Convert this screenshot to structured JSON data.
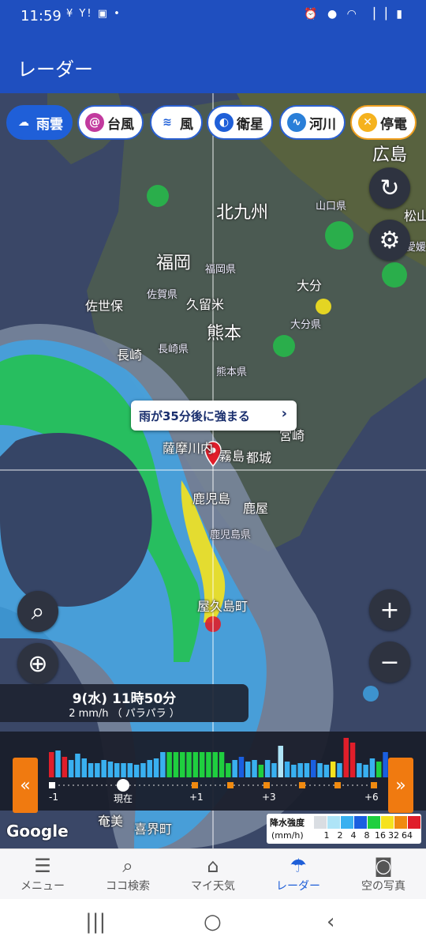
{
  "status_bar": {
    "time": "11:59",
    "left_icons": "¥ Y! ▣ •",
    "right_icons": "⏰ ● ◠ ▕▕ ▮"
  },
  "app_bar": {
    "title": "レーダー"
  },
  "layer_chips": [
    {
      "label": "雨雲",
      "icon": "cloud-rain-icon",
      "active": true
    },
    {
      "label": "台風",
      "icon": "typhoon-icon",
      "active": false
    },
    {
      "label": "風",
      "icon": "wind-icon",
      "active": false
    },
    {
      "label": "衛星",
      "icon": "satellite-icon",
      "active": false
    },
    {
      "label": "河川",
      "icon": "river-icon",
      "active": false
    },
    {
      "label": "停電",
      "icon": "power-outage-icon",
      "active": false
    }
  ],
  "map_labels": {
    "hiroshima": "広島",
    "yamaguchi_pref": "山口県",
    "matsuyama": "松山",
    "ehime_pref": "愛媛",
    "kitakyushu": "北九州",
    "fukuoka": "福岡",
    "fukuoka_pref": "福岡県",
    "saga_pref": "佐賀県",
    "kurume": "久留米",
    "sasebo": "佐世保",
    "oita": "大分",
    "oita_pref": "大分県",
    "kumamoto": "熊本",
    "nagasaki": "長崎",
    "nagasaki_pref": "長崎県",
    "kumamoto_pref": "熊本県",
    "miyazaki": "宮崎",
    "satsumasendai": "薩摩川内",
    "kirishima": "霧島",
    "miyakonojo": "都城",
    "kagoshima": "鹿児島",
    "kanoya": "鹿屋",
    "kagoshima_pref": "鹿児島県",
    "yakushima": "屋久島町",
    "amami": "奄美",
    "kikai": "喜界町"
  },
  "callout": {
    "text": "雨が35分後に強まる",
    "chevron": "›"
  },
  "time_panel": {
    "datetime": "9(水) 11時50分",
    "intensity": "2 mm/h （ パラパラ ）"
  },
  "timeline": {
    "labels": {
      "minus1": "-1",
      "now": "現在",
      "plus1": "+1",
      "plus3": "+3",
      "plus6": "+6"
    },
    "prev_icon": "«",
    "next_icon": "»"
  },
  "legend": {
    "title": "降水強度",
    "unit": "(mm/h)",
    "values": [
      "1",
      "2",
      "4",
      "8",
      "16",
      "32",
      "64"
    ],
    "colors": [
      "#d9dde2",
      "#aee4f7",
      "#39b0f0",
      "#1a5fe0",
      "#1fcf3f",
      "#f5e21e",
      "#f08a10",
      "#e01e2a"
    ]
  },
  "google": "Google",
  "bottom_nav": [
    {
      "label": "メニュー",
      "icon": "menu-icon",
      "active": false
    },
    {
      "label": "ココ検索",
      "icon": "search-icon",
      "active": false
    },
    {
      "label": "マイ天気",
      "icon": "home-icon",
      "active": false
    },
    {
      "label": "レーダー",
      "icon": "umbrella-icon",
      "active": true
    },
    {
      "label": "空の写真",
      "icon": "camera-icon",
      "active": false
    }
  ],
  "accent_color": "#1f5fd8"
}
